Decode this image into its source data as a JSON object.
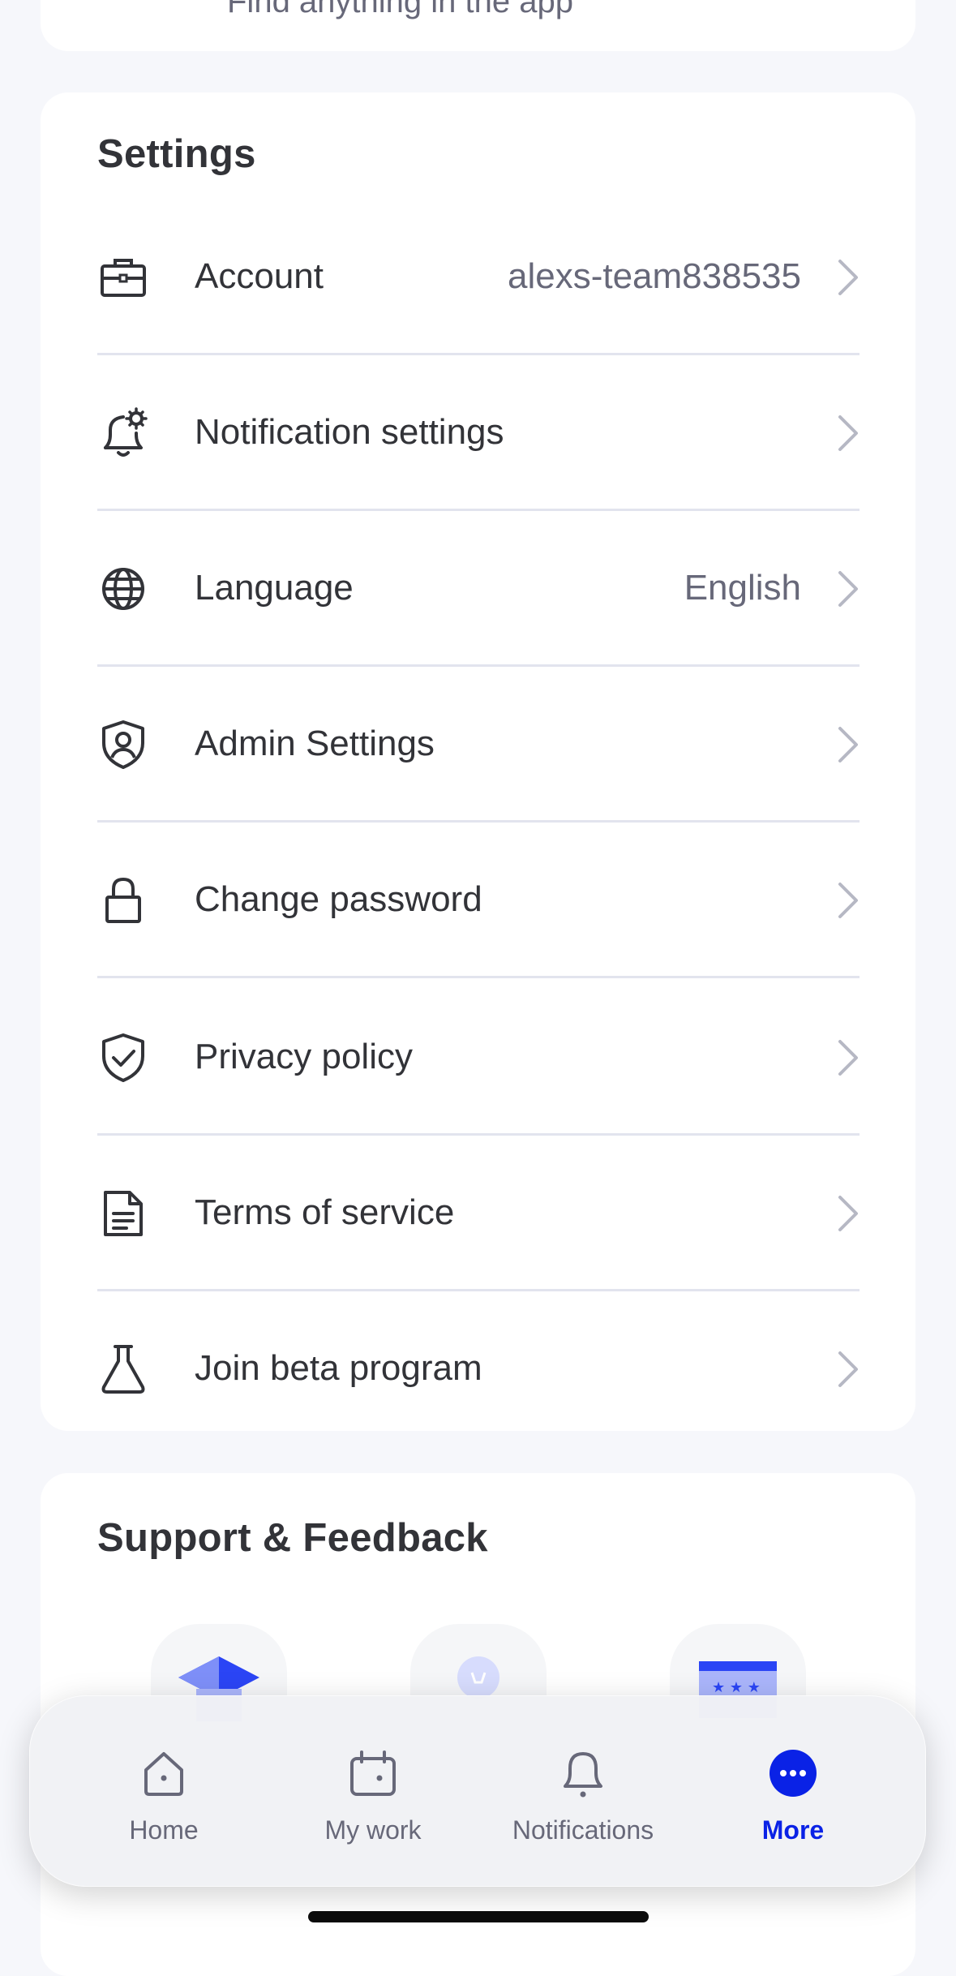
{
  "search": {
    "placeholder": "Find anything in the app"
  },
  "settings": {
    "title": "Settings",
    "items": [
      {
        "label": "Account",
        "value": "alexs-team838535",
        "icon": "briefcase-icon"
      },
      {
        "label": "Notification settings",
        "value": "",
        "icon": "bell-gear-icon"
      },
      {
        "label": "Language",
        "value": "English",
        "icon": "globe-icon"
      },
      {
        "label": "Admin Settings",
        "value": "",
        "icon": "shield-user-icon"
      },
      {
        "label": "Change password",
        "value": "",
        "icon": "lock-icon"
      },
      {
        "label": "Privacy policy",
        "value": "",
        "icon": "shield-check-icon"
      },
      {
        "label": "Terms of service",
        "value": "",
        "icon": "document-icon"
      },
      {
        "label": "Join beta program",
        "value": "",
        "icon": "flask-icon"
      }
    ]
  },
  "support": {
    "title": "Support & Feedback",
    "tiles": [
      "graduation-cap-icon",
      "lightbulb-icon",
      "calendar-stars-icon"
    ]
  },
  "tabbar": {
    "tabs": [
      {
        "label": "Home",
        "icon": "home-icon",
        "active": false
      },
      {
        "label": "My work",
        "icon": "calendar-icon",
        "active": false
      },
      {
        "label": "Notifications",
        "icon": "bell-icon",
        "active": false
      },
      {
        "label": "More",
        "icon": "more-icon",
        "active": true
      }
    ]
  },
  "colors": {
    "accent": "#0a22e6",
    "text": "#323338",
    "muted": "#676879",
    "divider": "#e2e4ee"
  }
}
